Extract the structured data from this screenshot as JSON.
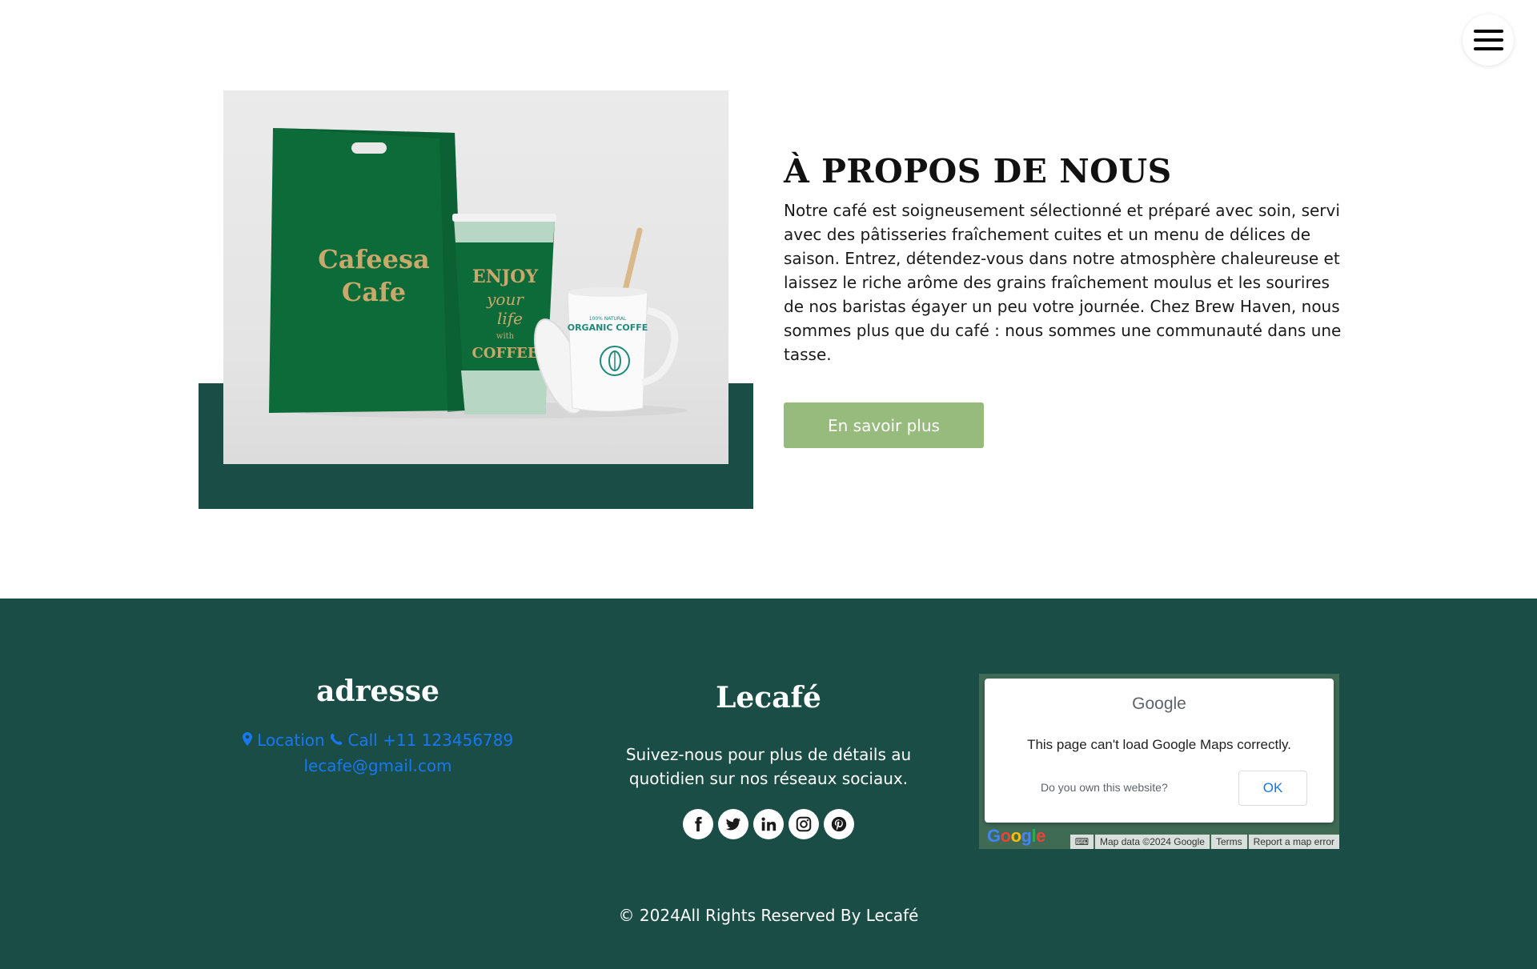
{
  "header": {
    "menu_icon": "hamburger-icon"
  },
  "about": {
    "title": "À PROPOS DE NOUS",
    "text": "Notre café est soigneusement sélectionné et préparé avec soin, servi avec des pâtisseries fraîchement cuites et un menu de délices de saison. Entrez, détendez-vous dans notre atmosphère chaleureuse et laissez le riche arôme des grains fraîchement moulus et les sourires de nos baristas égayer un peu votre journée. Chez Brew Haven, nous sommes plus que du café : nous sommes une communauté dans une tasse.",
    "button_label": "En savoir plus",
    "image": {
      "bag_text_line1": "Cafeesa",
      "bag_text_line2": "Cafe",
      "cup_text": [
        "ENJOY",
        "your",
        "life",
        "with",
        "COFFEE"
      ],
      "mug_text": "ORGANIC COFFE",
      "mug_small_text": "100% NATURAL"
    }
  },
  "footer": {
    "address": {
      "title": "adresse",
      "location_label": "Location",
      "call_label": "Call +11 123456789",
      "email": "lecafe@gmail.com"
    },
    "brand": {
      "title": "Lecafé",
      "follow_text": "Suivez-nous pour plus de détails au quotidien sur nos réseaux sociaux."
    },
    "socials": [
      "facebook-icon",
      "twitter-icon",
      "linkedin-icon",
      "instagram-icon",
      "pinterest-icon"
    ],
    "map": {
      "brand": "Google",
      "message": "This page can't load Google Maps correctly.",
      "own_question": "Do you own this website?",
      "ok_label": "OK",
      "data_label": "Map data ©2024 Google",
      "terms_label": "Terms",
      "report_label": "Report a map error"
    },
    "copyright": "© 2024All Rights Reserved By Lecafé"
  },
  "colors": {
    "dark_green": "#1b4d47",
    "button_green": "#97bb7c",
    "link_blue": "#1877f2",
    "bag_green": "#0d6b3a"
  }
}
